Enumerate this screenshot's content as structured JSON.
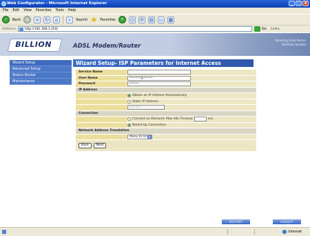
{
  "window": {
    "title": "Web Configurator - Microsoft Internet Explorer",
    "controls": {
      "minimize": "_",
      "maximize": "□",
      "close": "x"
    }
  },
  "menu": [
    "File",
    "Edit",
    "View",
    "Favorites",
    "Tools",
    "Help"
  ],
  "toolbar": {
    "back_label": "Back",
    "search_label": "Search",
    "favorites_label": "Favorites"
  },
  "address": {
    "label": "Address",
    "value": "http://192.168.1.254/",
    "go_label": "Go",
    "links_label": "Links"
  },
  "header": {
    "logo": "BILLION",
    "heading": "ADSL Modem/Router",
    "links": [
      "Reading Help Notes",
      "Hot/Get Update"
    ]
  },
  "sidebar": {
    "items": [
      {
        "label": "Wizard Setup"
      },
      {
        "label": "Advanced Setup"
      },
      {
        "label": "Status Router"
      },
      {
        "label": "Maintenance"
      }
    ]
  },
  "content": {
    "title": "Wizard Setup- ISP Parameters for Internet Access",
    "service_name": {
      "label": "Service Name",
      "value": ""
    },
    "user_name": {
      "label": "User Name",
      "value": "••••••@•••••"
    },
    "password": {
      "label": "Password",
      "value": "•••••"
    },
    "ip_address": {
      "section": "IP Address",
      "option_auto": "Obtain an IP Address Automatically",
      "option_static": "Static IP Address",
      "static_value": "0.0.0.0"
    },
    "connection": {
      "section": "Connection",
      "option_demand": "Connect on Demand: Max Idle Timeout",
      "timeout_value": "",
      "timeout_unit": "sec",
      "option_nailed": "Nailed-Up Connection"
    },
    "nat": {
      "section": "Network Address Translation",
      "value": "Many to One"
    },
    "buttons": {
      "back": "Back",
      "next": "Next"
    }
  },
  "bottom": {
    "restart": "RESTART",
    "logout": "LOGOUT"
  },
  "status": {
    "zone": "Internet"
  }
}
